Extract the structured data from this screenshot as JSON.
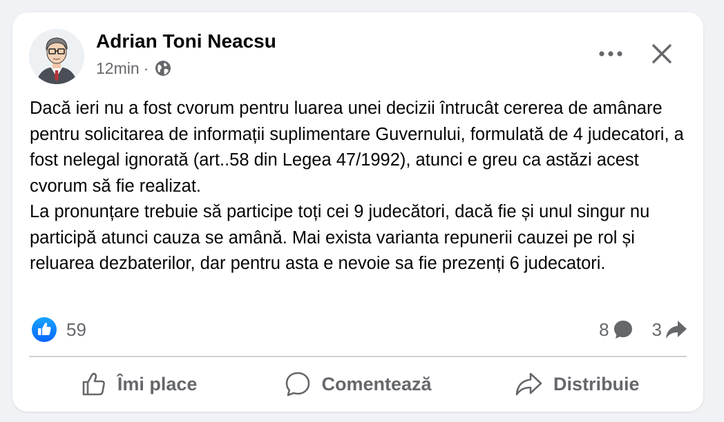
{
  "post": {
    "author": "Adrian Toni Neacsu",
    "time": "12min",
    "separator": "·",
    "audience_icon": "globe-icon",
    "paragraphs": [
      "Dacă ieri nu a fost cvorum pentru luarea unei decizii întrucât cererea de amânare pentru solicitarea de informații suplimentare Guvernului, formulată de 4 judecatori, a fost nelegal ignorată (art..58 din Legea 47/1992), atunci e greu ca astăzi acest cvorum să fie realizat.",
      "La pronunțare trebuie să participe toți cei 9 judecători,  dacă fie și unul singur nu participă atunci cauza se amână. Mai exista varianta repunerii cauzei pe rol și reluarea dezbaterilor, dar pentru asta e nevoie sa fie prezenți 6 judecatori."
    ]
  },
  "stats": {
    "reaction_icon": "like-reaction-icon",
    "reaction_count": "59",
    "comments": "8",
    "shares": "3"
  },
  "actions": {
    "like": "Îmi place",
    "comment": "Comentează",
    "share": "Distribuie"
  },
  "colors": {
    "primary_text": "#050505",
    "secondary_text": "#65676b",
    "like_blue": "#0866ff",
    "divider": "#ced0d4",
    "background": "#f0f2f5",
    "card": "#ffffff"
  }
}
